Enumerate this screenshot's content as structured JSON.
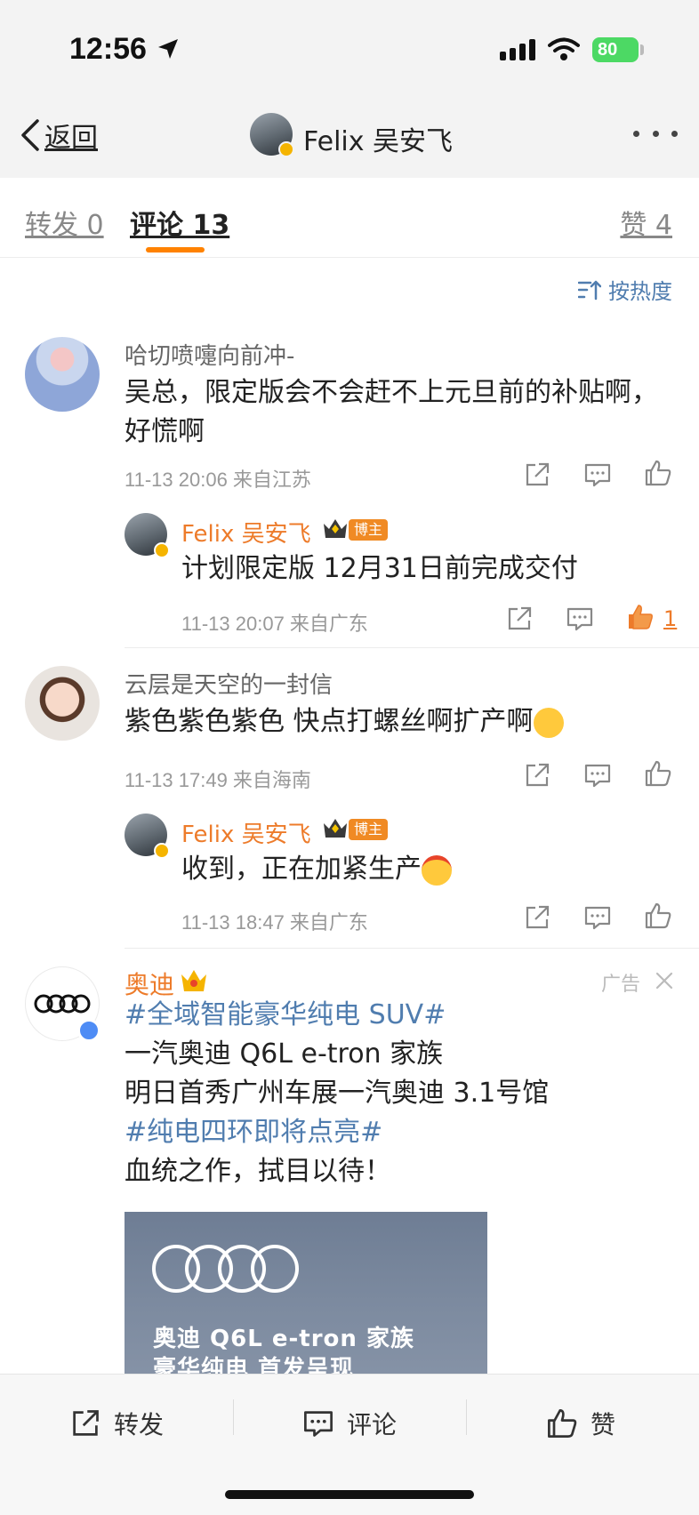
{
  "status_bar": {
    "time": "12:56",
    "battery": "80"
  },
  "nav": {
    "back_label": "返回",
    "title": "Felix 吴安飞"
  },
  "tabs": {
    "repost": "转发 0",
    "comments": "评论 13",
    "likes": "赞 4"
  },
  "sort_label": "按热度",
  "comments": [
    {
      "user": "哈切喷嚏向前冲-",
      "text_line1": "吴总，限定版会不会赶不上元旦前的补贴啊，",
      "text_line2": "好慌啊",
      "meta": "11-13 20:06  来自江苏",
      "reply": {
        "user": "Felix 吴安飞",
        "badge": "博主",
        "text": "计划限定版 12月31日前完成交付",
        "meta": "11-13 20:07  来自广东",
        "likes": "1"
      }
    },
    {
      "user": "云层是天空的一封信",
      "text": "紫色紫色紫色 快点打螺丝啊扩产啊",
      "meta": "11-13 17:49  来自海南",
      "reply": {
        "user": "Felix 吴安飞",
        "badge": "博主",
        "text": "收到，正在加紧生产",
        "meta": "11-13 18:47  来自广东"
      }
    }
  ],
  "ad": {
    "user": "奥迪",
    "label": "广告",
    "topic1": "#全域智能豪华纯电 SUV#",
    "line1": "一汽奥迪 Q6L e-tron 家族",
    "line2": "明日首秀广州车展一汽奥迪 3.1号馆",
    "topic2": "#纯电四环即将点亮#",
    "line3": "血统之作，拭目以待！",
    "image_line1": "奥迪 Q6L e-tron 家族",
    "image_line2": "豪华纯电  首发呈现"
  },
  "bottom_bar": {
    "repost": "转发",
    "comment": "评论",
    "like": "赞"
  },
  "colors": {
    "accent": "#ff8200",
    "link": "#507daf",
    "username_host": "#ed7b2a"
  }
}
